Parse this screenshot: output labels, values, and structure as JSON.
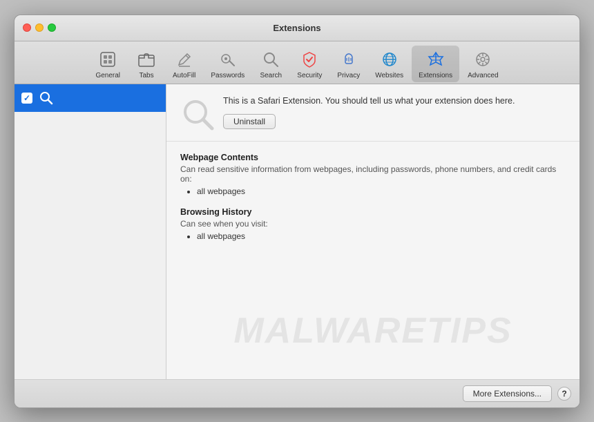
{
  "window": {
    "title": "Extensions"
  },
  "toolbar": {
    "items": [
      {
        "id": "general",
        "label": "General",
        "icon": "general"
      },
      {
        "id": "tabs",
        "label": "Tabs",
        "icon": "tabs"
      },
      {
        "id": "autofill",
        "label": "AutoFill",
        "icon": "autofill"
      },
      {
        "id": "passwords",
        "label": "Passwords",
        "icon": "passwords"
      },
      {
        "id": "search",
        "label": "Search",
        "icon": "search"
      },
      {
        "id": "security",
        "label": "Security",
        "icon": "security"
      },
      {
        "id": "privacy",
        "label": "Privacy",
        "icon": "privacy"
      },
      {
        "id": "websites",
        "label": "Websites",
        "icon": "websites"
      },
      {
        "id": "extensions",
        "label": "Extensions",
        "icon": "extensions",
        "active": true
      },
      {
        "id": "advanced",
        "label": "Advanced",
        "icon": "advanced"
      }
    ]
  },
  "sidebar": {
    "items": [
      {
        "id": "search-ext",
        "label": "",
        "checked": true,
        "selected": true
      }
    ]
  },
  "extension": {
    "description": "This is a Safari Extension. You should tell us what your extension does here.",
    "uninstall_label": "Uninstall",
    "permissions": [
      {
        "title": "Webpage Contents",
        "description": "Can read sensitive information from webpages, including passwords, phone numbers, and credit cards on:",
        "items": [
          "all webpages"
        ]
      },
      {
        "title": "Browsing History",
        "description": "Can see when you visit:",
        "items": [
          "all webpages"
        ]
      }
    ]
  },
  "bottom": {
    "more_extensions_label": "More Extensions...",
    "help_label": "?"
  },
  "watermark": {
    "text": "MALWARETIPS"
  }
}
